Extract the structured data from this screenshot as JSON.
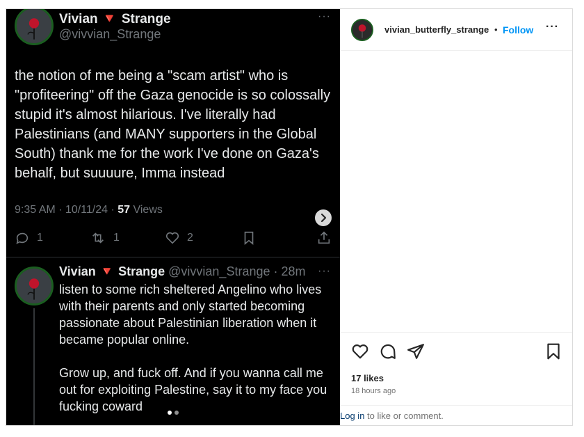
{
  "tweet": {
    "name": "Vivian 🔻 Strange",
    "handle": "@vivvian_Strange",
    "more": "···",
    "body": "the notion of me being a \"scam artist\" who is \"profiteering\" off the Gaza genocide is so colossally stupid it's almost hilarious. I've literally had Palestinians (and MANY supporters in the Global South) thank me for the work I've done on Gaza's behalf, but suuuure, Imma instead",
    "time": "9:35 AM · 10/11/24 · ",
    "views_count": "57",
    "views_label": " Views",
    "replies": "1",
    "reposts": "1",
    "likes": "2"
  },
  "reply": {
    "name": "Vivian 🔻 Strange",
    "handle_time": " @vivvian_Strange · 28m",
    "more": "···",
    "para1": "listen to some rich sheltered Angelino who lives with their parents and only started becoming passionate about Palestinian liberation when it became popular online.",
    "para2": "Grow up, and fuck off. And if you wanna call me out for exploiting Palestine, say it to my face you fucking coward"
  },
  "post": {
    "username": "vivian_butterfly_strange",
    "bullet": "•",
    "follow": "Follow",
    "more": "···",
    "likes": "17 likes",
    "time": "18 hours ago",
    "login_link": "Log in",
    "login_text": " to like or comment."
  },
  "icons": {
    "like": "heart-icon",
    "comment": "comment-icon",
    "share": "share-icon",
    "save": "bookmark-icon"
  },
  "colors": {
    "follow": "#0095f6",
    "tweet_bg": "#000000",
    "tweet_muted": "#71767b"
  }
}
